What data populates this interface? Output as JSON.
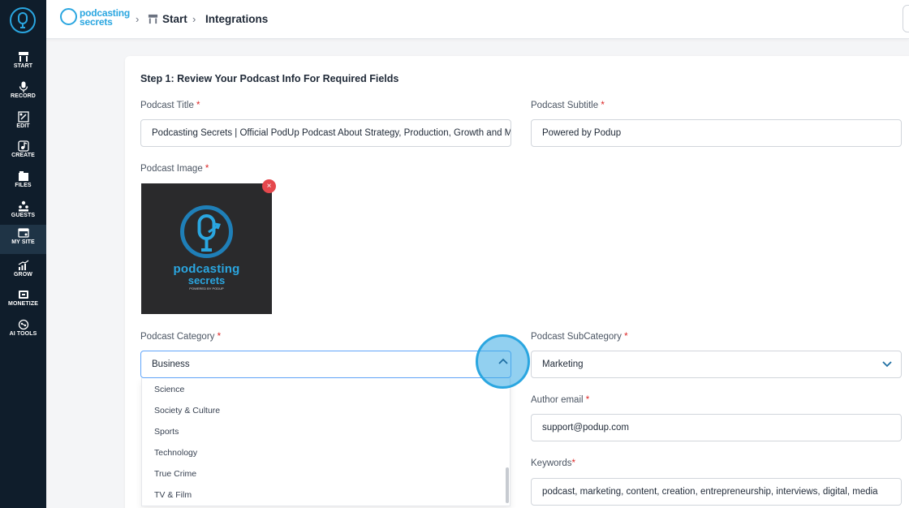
{
  "sidebar": {
    "items": [
      {
        "label": "START",
        "icon": "start-icon"
      },
      {
        "label": "RECORD",
        "icon": "mic-icon"
      },
      {
        "label": "EDIT",
        "icon": "edit-icon"
      },
      {
        "label": "CREATE",
        "icon": "create-icon"
      },
      {
        "label": "FILES",
        "icon": "files-icon"
      },
      {
        "label": "GUESTS",
        "icon": "guests-icon"
      },
      {
        "label": "MY SITE",
        "icon": "site-icon",
        "active": true
      },
      {
        "label": "GROW",
        "icon": "grow-icon"
      },
      {
        "label": "MONETIZE",
        "icon": "monetize-icon"
      },
      {
        "label": "AI TOOLS",
        "icon": "ai-tools-icon"
      }
    ]
  },
  "brand": {
    "line1": "podcasting",
    "line2": "secrets"
  },
  "breadcrumb": {
    "start": "Start",
    "current": "Integrations"
  },
  "form": {
    "step_title": "Step 1: Review Your Podcast Info For Required Fields",
    "title_label": "Podcast Title",
    "title_value": "Podcasting Secrets | Official PodUp Podcast About Strategy, Production, Growth and Marketing",
    "subtitle_label": "Podcast Subtitle",
    "subtitle_value": "Powered by Podup",
    "image_label": "Podcast Image",
    "image_text": {
      "line1": "podcasting",
      "line2": "secrets",
      "line3": "POWERED BY PODUP"
    },
    "remove_icon": "×",
    "required_mark": "*",
    "category_label": "Podcast Category",
    "category_value": "Business",
    "category_options": [
      "Science",
      "Society & Culture",
      "Sports",
      "Technology",
      "True Crime",
      "TV & Film"
    ],
    "subcategory_label": "Podcast SubCategory",
    "subcategory_value": "Marketing",
    "author_email_label": "Author email",
    "author_email_value": "support@podup.com",
    "keywords_label": "Keywords",
    "keywords_value": "podcast, marketing, content, creation, entrepreneurship, interviews, digital, media"
  },
  "colors": {
    "accent": "#2aa6e0",
    "sidebar_bg": "#0f1d2b",
    "required": "#dc2626"
  }
}
